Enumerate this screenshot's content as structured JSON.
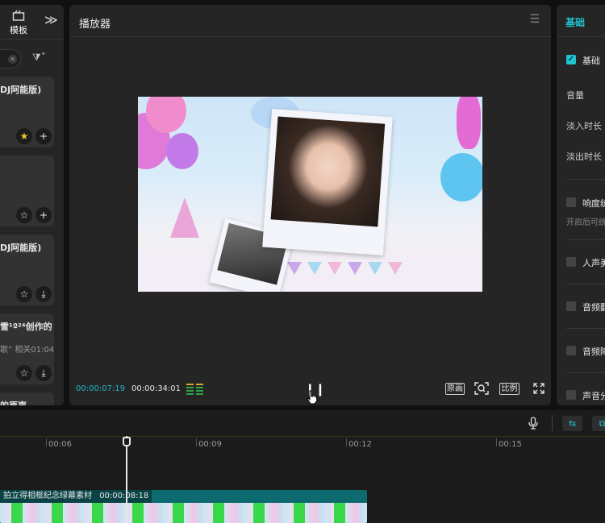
{
  "left_panel": {
    "top_tab_label": "模板",
    "expand_icon": "double-chevron-right-icon",
    "cards": [
      {
        "title": "DJ阿能版)",
        "sub": "",
        "b1": "★",
        "b2": "+"
      },
      {
        "title": "",
        "sub": "",
        "b1": "☆",
        "b2": "+"
      },
      {
        "title": "DJ阿能版)",
        "sub": "",
        "b1": "☆",
        "b2": "⤓"
      },
      {
        "title": "雪¹º²⁴创作的",
        "sub": "歌” 相关01:04",
        "b1": "☆",
        "b2": "⤓"
      },
      {
        "title": "的原声",
        "sub": "",
        "b1": "",
        "b2": ""
      }
    ]
  },
  "player": {
    "title": "播放器",
    "current_time": "00:00:07:19",
    "total_time": "00:00:34:01",
    "controls": {
      "original": "原画",
      "ratio": "比例"
    },
    "colors": {
      "accent": "#1fb7c4"
    }
  },
  "right_panel": {
    "tab": "基础",
    "basic_label": "基础",
    "volume_label": "音量",
    "fade_in_label": "淡入时长",
    "fade_out_label": "淡出时长",
    "loudness_label": "响度统",
    "loudness_hint": "开启后可统",
    "voice_label": "人声美",
    "audio1_label": "音频翻",
    "audio2_label": "音频降",
    "sound_label": "声音分"
  },
  "timeline": {
    "ruler_labels": [
      "00:06",
      "00:09",
      "00:12",
      "00:15"
    ],
    "clip": {
      "name": "拍立得相框纪念绿幕素材",
      "duration": "00:00:08:18"
    }
  }
}
